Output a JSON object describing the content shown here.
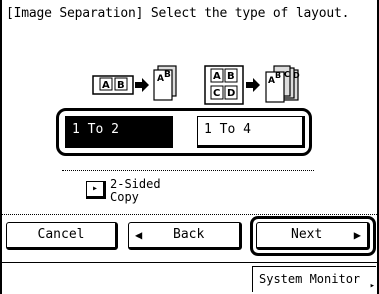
{
  "header": {
    "title": "[Image Separation] Select the type of layout."
  },
  "illustrations": {
    "left": {
      "page_letters": [
        "A",
        "B"
      ],
      "result_letters": [
        "A",
        "B"
      ]
    },
    "right": {
      "page_letters": [
        "A",
        "B",
        "C",
        "D"
      ],
      "result_letters": [
        "A",
        "B",
        "C",
        "D"
      ]
    }
  },
  "layout_options": [
    {
      "label": "1 To 2",
      "selected": true
    },
    {
      "label": "1 To 4",
      "selected": false
    }
  ],
  "sided": {
    "label": "2-Sided\nCopy",
    "toggle_glyph": "▸"
  },
  "footer": {
    "cancel_label": "Cancel",
    "back_label": "Back",
    "next_label": "Next",
    "back_icon": "◀",
    "next_icon": "▶"
  },
  "status": {
    "system_monitor_label": "System Monitor",
    "system_monitor_icon": "▸"
  }
}
